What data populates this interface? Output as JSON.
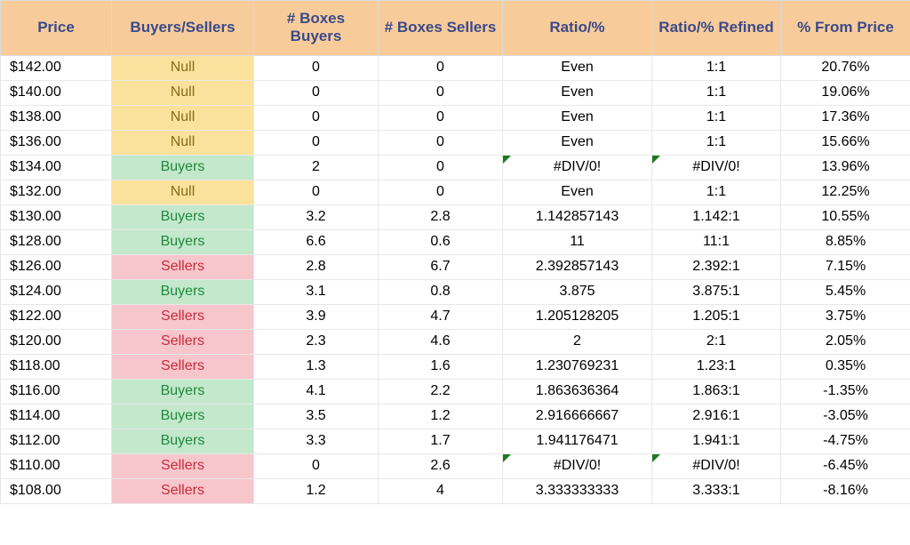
{
  "headers": {
    "price": "Price",
    "buyers_sellers": "Buyers/Sellers",
    "boxes_buyers": "# Boxes Buyers",
    "boxes_sellers": "# Boxes Sellers",
    "ratio": "Ratio/%",
    "ratio_refined": "Ratio/% Refined",
    "from_price": "% From Price"
  },
  "rows": [
    {
      "price": "$142.00",
      "bs": "Null",
      "bs_class": "null-cell",
      "bb": "0",
      "bs_boxes": "0",
      "ratio": "Even",
      "ratio_err": false,
      "refined": "1:1",
      "refined_err": false,
      "from": "20.76%"
    },
    {
      "price": "$140.00",
      "bs": "Null",
      "bs_class": "null-cell",
      "bb": "0",
      "bs_boxes": "0",
      "ratio": "Even",
      "ratio_err": false,
      "refined": "1:1",
      "refined_err": false,
      "from": "19.06%"
    },
    {
      "price": "$138.00",
      "bs": "Null",
      "bs_class": "null-cell",
      "bb": "0",
      "bs_boxes": "0",
      "ratio": "Even",
      "ratio_err": false,
      "refined": "1:1",
      "refined_err": false,
      "from": "17.36%"
    },
    {
      "price": "$136.00",
      "bs": "Null",
      "bs_class": "null-cell",
      "bb": "0",
      "bs_boxes": "0",
      "ratio": "Even",
      "ratio_err": false,
      "refined": "1:1",
      "refined_err": false,
      "from": "15.66%"
    },
    {
      "price": "$134.00",
      "bs": "Buyers",
      "bs_class": "buyers-cell",
      "bb": "2",
      "bs_boxes": "0",
      "ratio": "#DIV/0!",
      "ratio_err": true,
      "refined": "#DIV/0!",
      "refined_err": true,
      "from": "13.96%"
    },
    {
      "price": "$132.00",
      "bs": "Null",
      "bs_class": "null-cell",
      "bb": "0",
      "bs_boxes": "0",
      "ratio": "Even",
      "ratio_err": false,
      "refined": "1:1",
      "refined_err": false,
      "from": "12.25%"
    },
    {
      "price": "$130.00",
      "bs": "Buyers",
      "bs_class": "buyers-cell",
      "bb": "3.2",
      "bs_boxes": "2.8",
      "ratio": "1.142857143",
      "ratio_err": false,
      "refined": "1.142:1",
      "refined_err": false,
      "from": "10.55%"
    },
    {
      "price": "$128.00",
      "bs": "Buyers",
      "bs_class": "buyers-cell",
      "bb": "6.6",
      "bs_boxes": "0.6",
      "ratio": "11",
      "ratio_err": false,
      "refined": "11:1",
      "refined_err": false,
      "from": "8.85%"
    },
    {
      "price": "$126.00",
      "bs": "Sellers",
      "bs_class": "sellers-cell",
      "bb": "2.8",
      "bs_boxes": "6.7",
      "ratio": "2.392857143",
      "ratio_err": false,
      "refined": "2.392:1",
      "refined_err": false,
      "from": "7.15%"
    },
    {
      "price": "$124.00",
      "bs": "Buyers",
      "bs_class": "buyers-cell",
      "bb": "3.1",
      "bs_boxes": "0.8",
      "ratio": "3.875",
      "ratio_err": false,
      "refined": "3.875:1",
      "refined_err": false,
      "from": "5.45%"
    },
    {
      "price": "$122.00",
      "bs": "Sellers",
      "bs_class": "sellers-cell",
      "bb": "3.9",
      "bs_boxes": "4.7",
      "ratio": "1.205128205",
      "ratio_err": false,
      "refined": "1.205:1",
      "refined_err": false,
      "from": "3.75%"
    },
    {
      "price": "$120.00",
      "bs": "Sellers",
      "bs_class": "sellers-cell",
      "bb": "2.3",
      "bs_boxes": "4.6",
      "ratio": "2",
      "ratio_err": false,
      "refined": "2:1",
      "refined_err": false,
      "from": "2.05%"
    },
    {
      "price": "$118.00",
      "bs": "Sellers",
      "bs_class": "sellers-cell",
      "bb": "1.3",
      "bs_boxes": "1.6",
      "ratio": "1.230769231",
      "ratio_err": false,
      "refined": "1.23:1",
      "refined_err": false,
      "from": "0.35%"
    },
    {
      "price": "$116.00",
      "bs": "Buyers",
      "bs_class": "buyers-cell",
      "bb": "4.1",
      "bs_boxes": "2.2",
      "ratio": "1.863636364",
      "ratio_err": false,
      "refined": "1.863:1",
      "refined_err": false,
      "from": "-1.35%"
    },
    {
      "price": "$114.00",
      "bs": "Buyers",
      "bs_class": "buyers-cell",
      "bb": "3.5",
      "bs_boxes": "1.2",
      "ratio": "2.916666667",
      "ratio_err": false,
      "refined": "2.916:1",
      "refined_err": false,
      "from": "-3.05%"
    },
    {
      "price": "$112.00",
      "bs": "Buyers",
      "bs_class": "buyers-cell",
      "bb": "3.3",
      "bs_boxes": "1.7",
      "ratio": "1.941176471",
      "ratio_err": false,
      "refined": "1.941:1",
      "refined_err": false,
      "from": "-4.75%"
    },
    {
      "price": "$110.00",
      "bs": "Sellers",
      "bs_class": "sellers-cell",
      "bb": "0",
      "bs_boxes": "2.6",
      "ratio": "#DIV/0!",
      "ratio_err": true,
      "refined": "#DIV/0!",
      "refined_err": true,
      "from": "-6.45%"
    },
    {
      "price": "$108.00",
      "bs": "Sellers",
      "bs_class": "sellers-cell",
      "bb": "1.2",
      "bs_boxes": "4",
      "ratio": "3.333333333",
      "ratio_err": false,
      "refined": "3.333:1",
      "refined_err": false,
      "from": "-8.16%"
    }
  ]
}
